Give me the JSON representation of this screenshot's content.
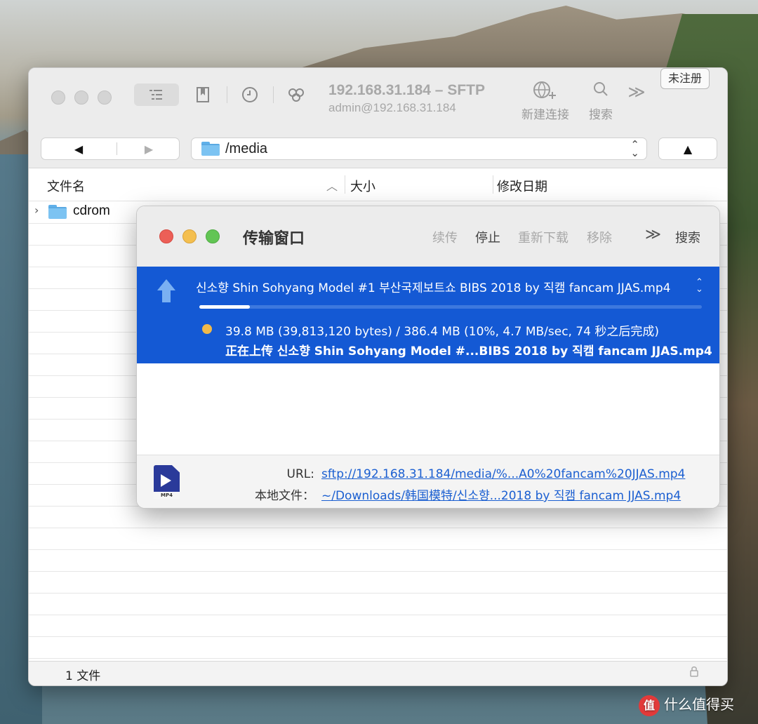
{
  "main_window": {
    "title": "192.168.31.184 – SFTP",
    "subtitle": "admin@192.168.31.184",
    "toolbar": {
      "new_connection_label": "新建连接",
      "search_label": "搜索",
      "more_label": "≫"
    },
    "unregistered_label": "未注册",
    "nav": {
      "back": "◀",
      "forward": "▶",
      "up": "▲",
      "path": "/media",
      "stepper": "⌃⌄"
    },
    "columns": {
      "name": "文件名",
      "size": "大小",
      "modified": "修改日期"
    },
    "files": [
      {
        "name": "cdrom",
        "type": "folder"
      }
    ],
    "status": "1 文件"
  },
  "transfer_window": {
    "title": "传输窗口",
    "actions": {
      "resume": "续传",
      "stop": "停止",
      "redownload": "重新下载",
      "remove": "移除",
      "more": "≫",
      "search": "搜索"
    },
    "item": {
      "filename": "신소향 Shin Sohyang Model #1 부산국제보트쇼 BIBS 2018 by 직캠 fancam JJAS.mp4",
      "progress": 0.1,
      "stats": "39.8 MB (39,813,120 bytes) / 386.4 MB (10%, 4.7 MB/sec, 74 秒之后完成)",
      "status": "正在上传 신소향 Shin Sohyang Model #...BIBS 2018 by 직캠 fancam JJAS.mp4"
    },
    "details": {
      "url_label": "URL:",
      "url_value": "sftp://192.168.31.184/media/%...A0%20fancam%20JJAS.mp4",
      "local_label": "本地文件：",
      "local_value": "~/Downloads/韩国模特/신소향...2018 by 직캠 fancam JJAS.mp4",
      "file_type_label": "MP4"
    },
    "colors": {
      "selection": "#1459d4",
      "close": "#ec5f57",
      "minimize": "#f4bf4f",
      "zoom": "#62c554"
    }
  },
  "watermark": {
    "badge": "值",
    "text": "什么值得买"
  }
}
